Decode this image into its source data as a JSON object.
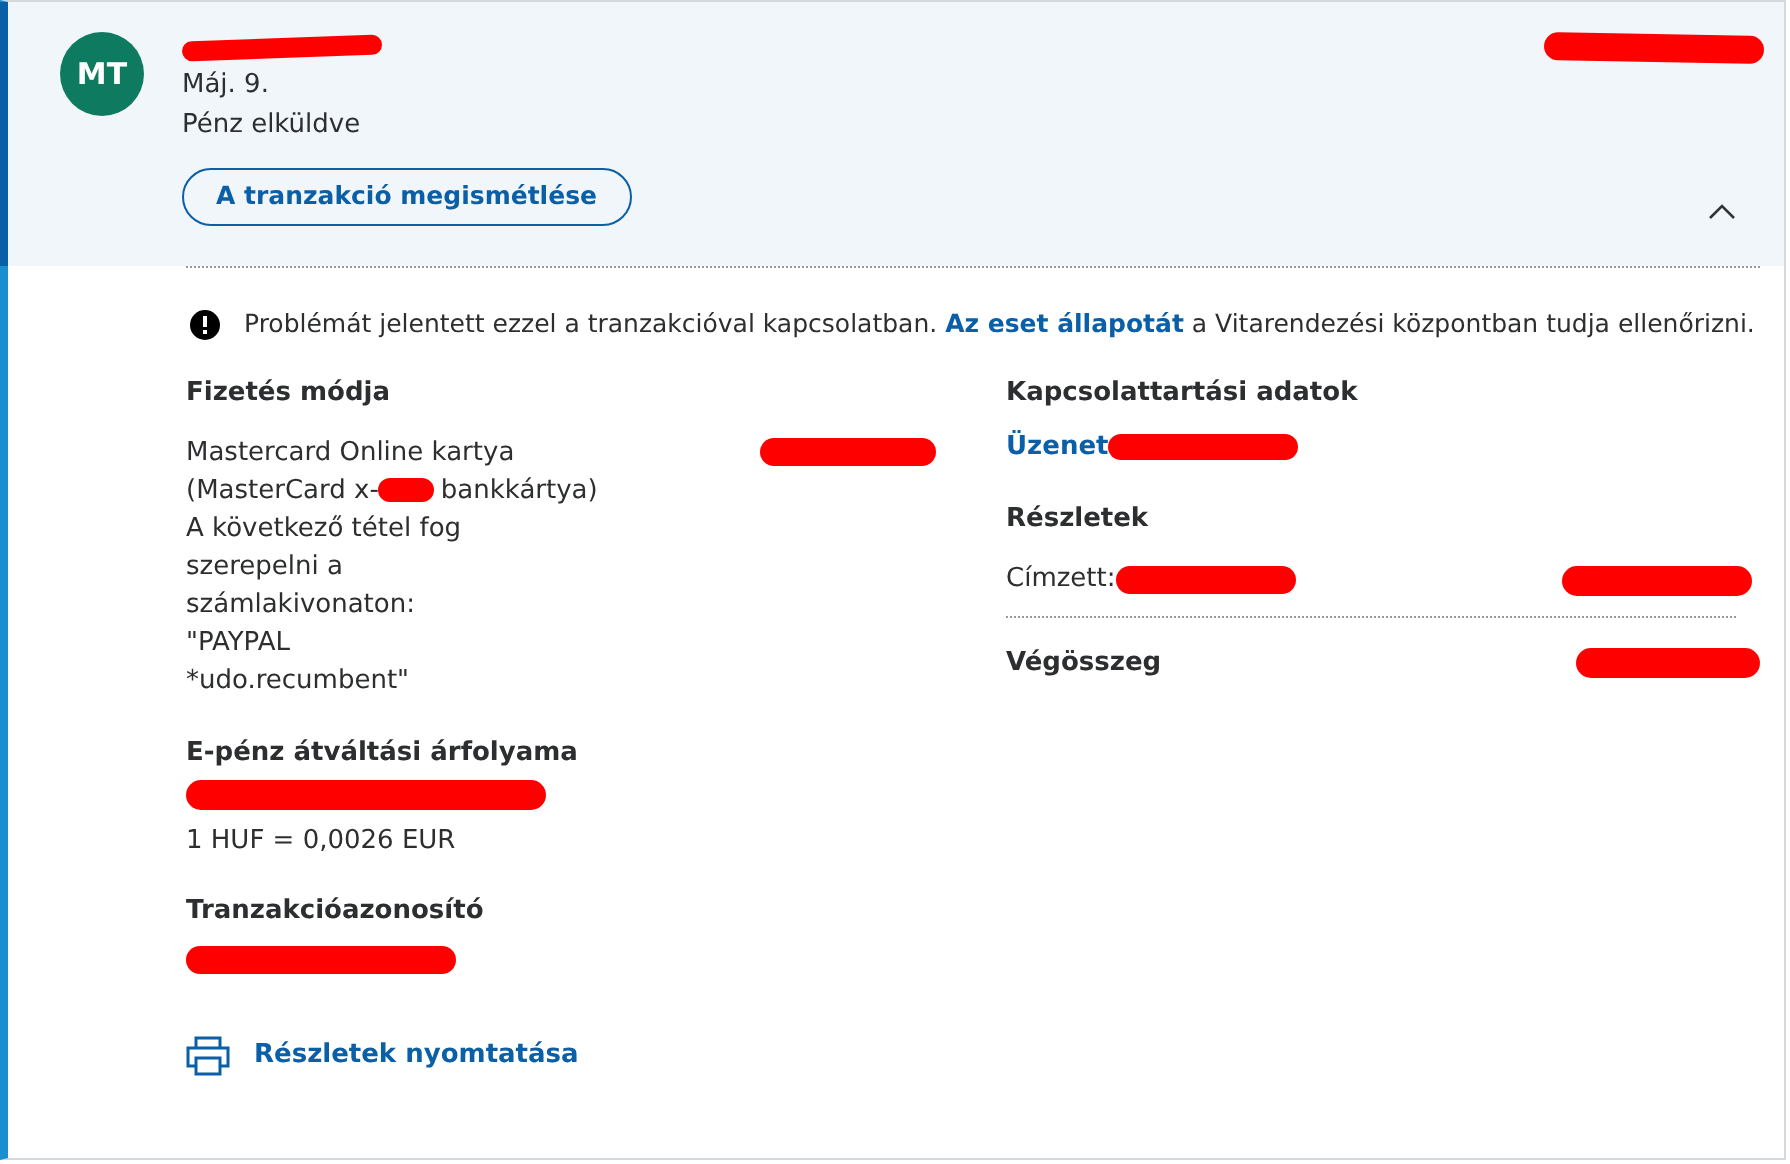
{
  "header": {
    "avatar": "MT",
    "date": "Máj. 9.",
    "status": "Pénz elküldve",
    "repeat_button": "A tranzakció megismétlése",
    "expanded": true
  },
  "notice": {
    "text": "Problémát jelentett ezzel a tranzakcióval kapcsolatban.",
    "link": "Az eset állapotát",
    "suffix": "a Vitarendezési központban tudja ellenőrizni."
  },
  "payment": {
    "heading": "Fizetés módja",
    "card": "Mastercard Online kartya",
    "card_prefix": "(MasterCard x-",
    "card_suffix": "bankkártya)",
    "statement_lines": [
      "A következő tétel fog",
      "szerepelni a",
      "számlakivonaton:",
      "\"PAYPAL",
      "*udo.recumbent\""
    ]
  },
  "exchange": {
    "heading": "E-pénz átváltási árfolyama",
    "rate": "1 HUF = 0,0026 EUR"
  },
  "transaction": {
    "heading": "Tranzakcióazonosító"
  },
  "print_link": "Részletek nyomtatása",
  "contact": {
    "heading": "Kapcsolattartási adatok",
    "link": "Üzenet"
  },
  "details": {
    "heading": "Részletek",
    "recipient_label": "Címzett:",
    "total_label": "Végösszeg"
  }
}
